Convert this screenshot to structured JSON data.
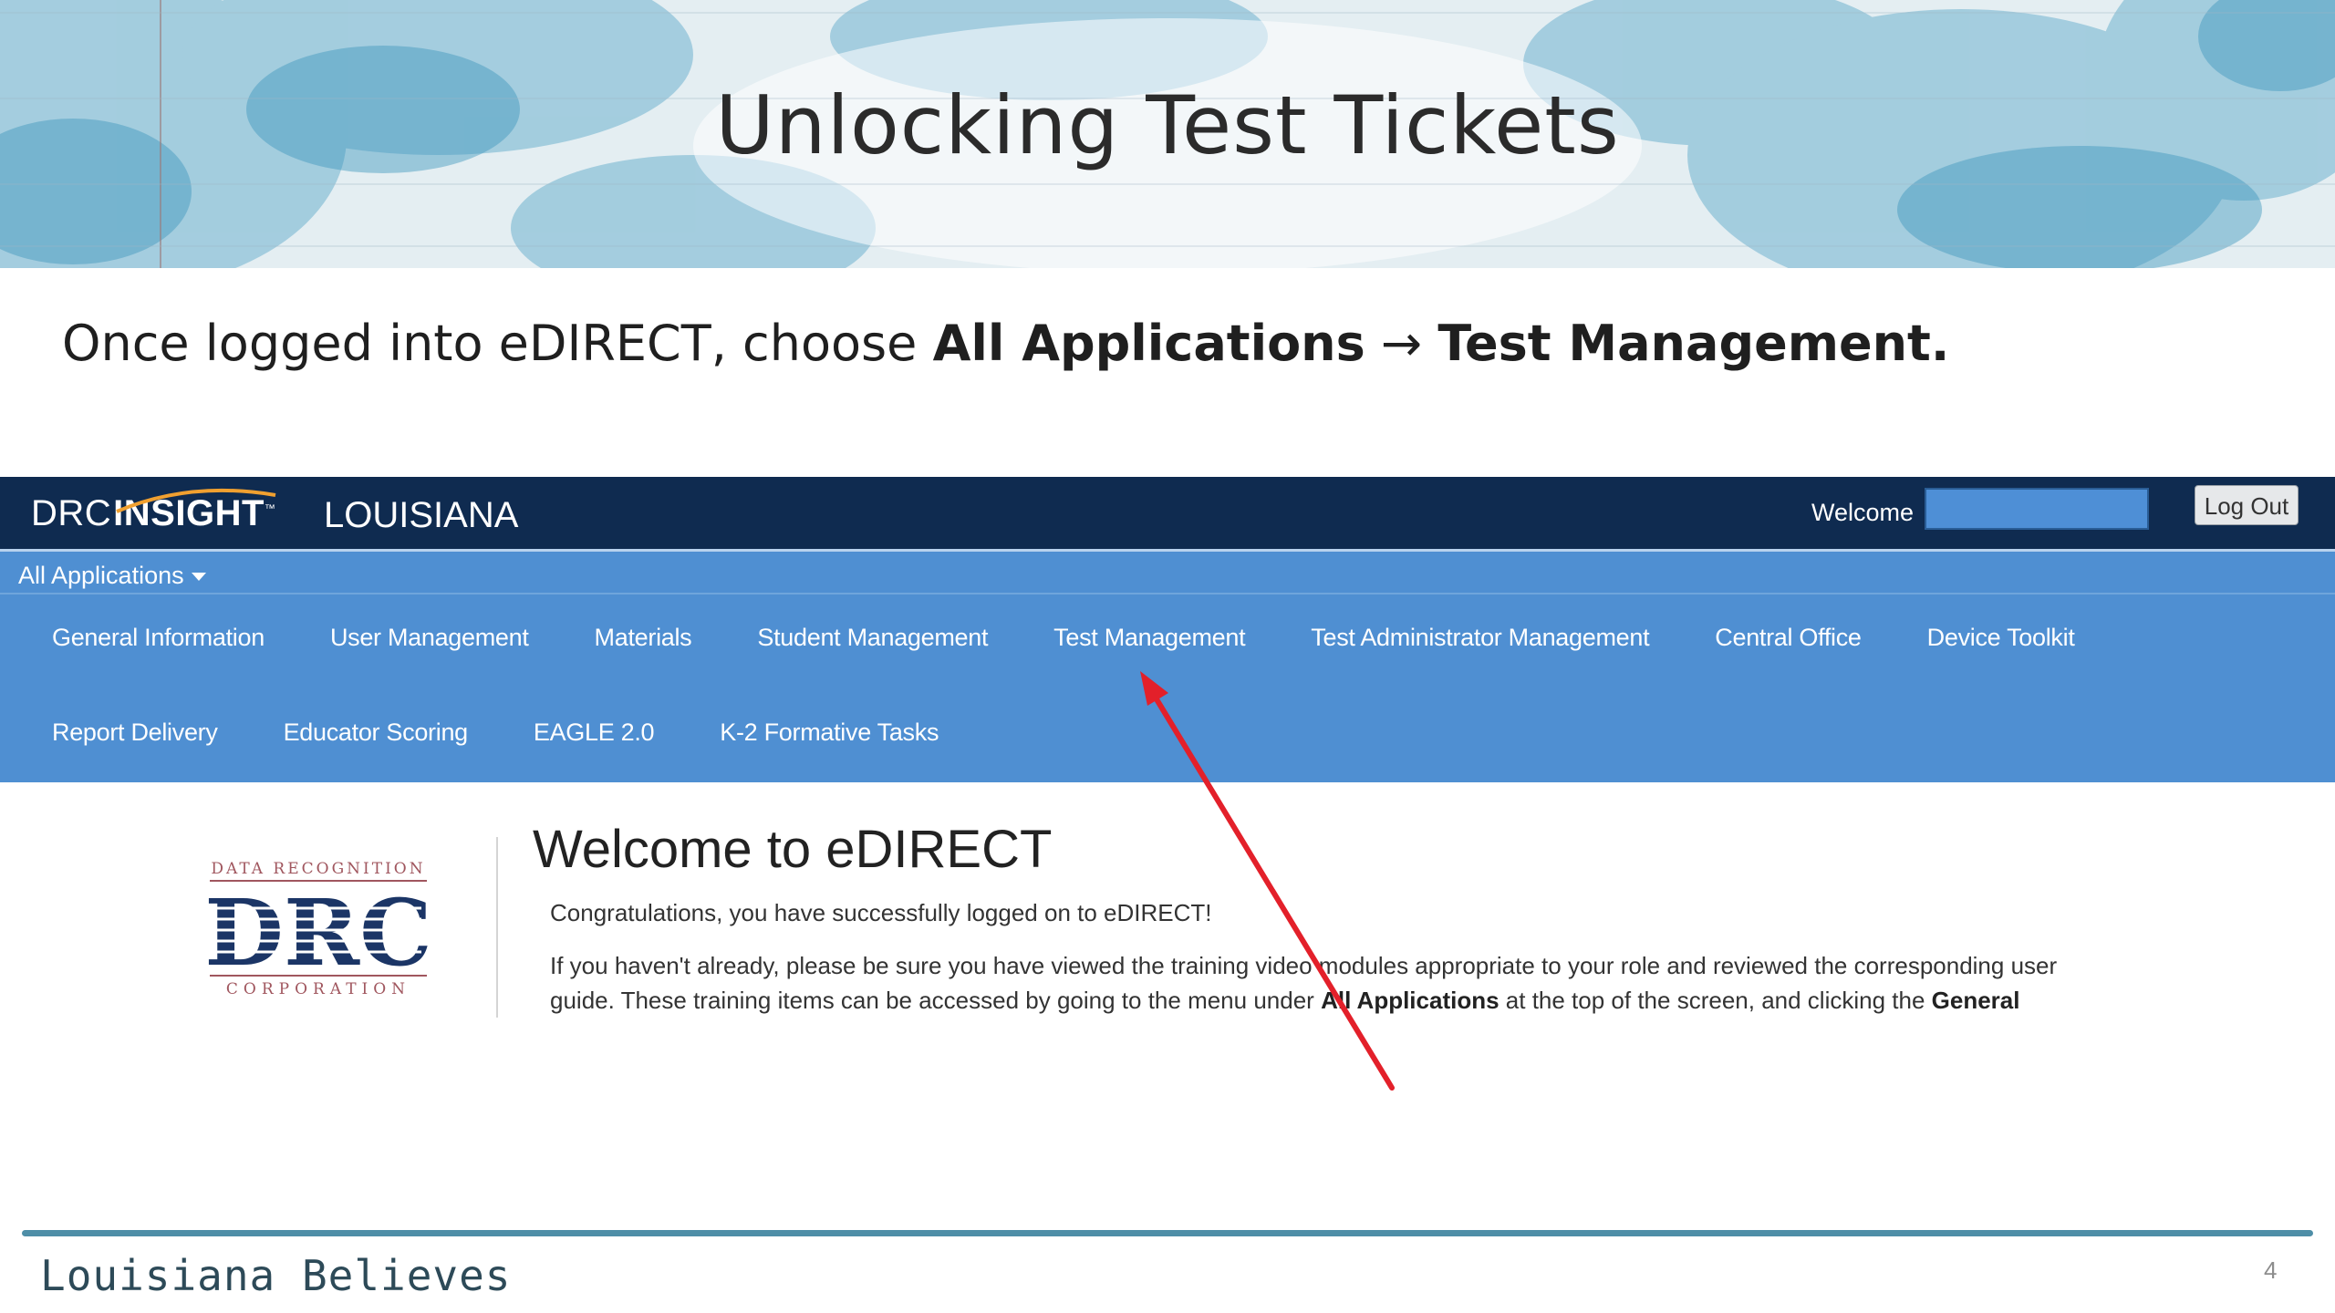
{
  "slide": {
    "title": "Unlocking Test Tickets",
    "instruction": {
      "prefix": "Once logged into eDIRECT, choose ",
      "bold1": "All Applications",
      "arrow": " → ",
      "bold2": "Test Management."
    },
    "footer_brand": "Louisiana Believes",
    "page_number": "4"
  },
  "header": {
    "brand_drc": "DRC",
    "brand_insight": "INSIGHT",
    "trademark": "™",
    "state": "LOUISIANA",
    "welcome_label": "Welcome",
    "logout_label": "Log Out"
  },
  "nav": {
    "all_apps_label": "All Applications",
    "row1": [
      "General Information",
      "User Management",
      "Materials",
      "Student Management",
      "Test Management",
      "Test Administrator Management",
      "Central Office",
      "Device Toolkit"
    ],
    "row2": [
      "Report Delivery",
      "Educator Scoring",
      "EAGLE 2.0",
      "K-2 Formative Tasks"
    ]
  },
  "welcome": {
    "title": "Welcome to eDIRECT",
    "congrats": "Congratulations, you have successfully logged on to eDIRECT!",
    "info_part1": "If you haven't already, please be sure you have viewed the training video modules appropriate to your role and reviewed the corresponding user guide. These training items can be accessed by going to the menu under ",
    "info_bold1": "All Applications",
    "info_part2": " at the top of the screen, and clicking the ",
    "info_bold2": "General"
  },
  "logo": {
    "top_text": "DATA RECOGNITION",
    "main_text": "DRC",
    "bottom_text": "CORPORATION"
  },
  "colors": {
    "header_bg": "#0f2b50",
    "nav_bg": "#4f8fd2",
    "arrow": "#e3202a",
    "footer_line": "#4e8ea7"
  }
}
